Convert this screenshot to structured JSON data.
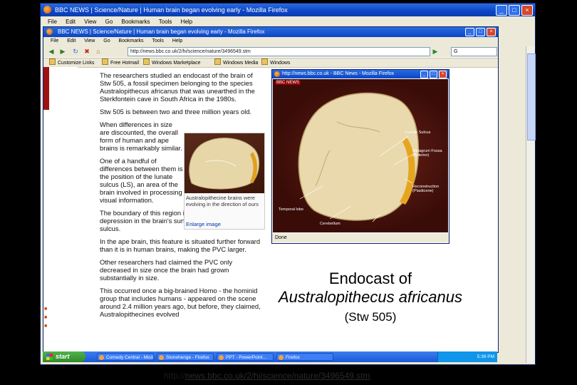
{
  "outer_window": {
    "title": "BBC NEWS | Science/Nature | Human brain began evolving early - Mozilla Firefox",
    "menu": [
      "File",
      "Edit",
      "View",
      "Go",
      "Bookmarks",
      "Tools",
      "Help"
    ],
    "buttons": [
      "_",
      "□",
      "×"
    ]
  },
  "inner_window": {
    "title": "BBC NEWS | Science/Nature | Human brain began evolving early - Mozilla Firefox",
    "menu": [
      "File",
      "Edit",
      "View",
      "Go",
      "Bookmarks",
      "Tools",
      "Help"
    ],
    "buttons": [
      "_",
      "□",
      "×"
    ],
    "url": "http://news.bbc.co.uk/2/hi/science/nature/3496549.stm",
    "search_placeholder": "G",
    "bookmarks": [
      "Customize Links",
      "Free Hotmail",
      "Windows Marketplace",
      "Windows Media",
      "Windows"
    ]
  },
  "article": {
    "paragraphs": [
      "The researchers studied an endocast of the brain of Stw 505, a fossil specimen belonging to the species Australopithecus africanus that was unearthed in the Sterkfontein cave in South Africa in the 1980s.",
      "Stw 505 is between two and three million years old.",
      "When differences in size are discounted, the overall form of human and ape brains is remarkably similar.",
      "One of a handful of differences between them is the position of the lunate sulcus (LS), an area of the brain involved in processing visual information.",
      "The boundary of this region is defined by an arching depression in the brain's surface called the lunate sulcus.",
      "In the ape brain, this feature is situated further forward than it is in human brains, making the PVC larger.",
      "Other researchers had claimed the PVC only decreased in size once the brain had grown substantially in size.",
      "This occurred once a big-brained Homo - the hominid group that includes humans - appeared on the scene around 2.4 million years ago, but before, they claimed, Australopithecines evolved"
    ],
    "figure": {
      "caption": "Australopithecine brains were evolving in the direction of ours",
      "link": "Enlarge image"
    }
  },
  "popup": {
    "title": "http://news.bbc.co.uk - BBC News - Mozilla Firefox",
    "brand": "BBC NEWS",
    "labels": {
      "lunate": "Lunate Sulcus",
      "malagrum": "Malagrum Fossa (Anterior)",
      "recon": "Reconstruction (Plasticene)",
      "temporal": "Temporal lobe",
      "cerebellum": "Cerebellum"
    },
    "status": "Done"
  },
  "caption": {
    "line1": "Endocast of",
    "line2": "Australopithecus africanus",
    "line3": "(Stw 505)"
  },
  "taskbar": {
    "start": "start",
    "items": [
      "Comedy Central - Mozilla...",
      "Stonehenge - Firefox",
      "PPT - PowerPoint...",
      "Firefox"
    ],
    "tray": "5:39 PM"
  },
  "source": {
    "prefix": "http://",
    "link": "news.bbc.co.uk/2/hi/science/nature/3496549.stm"
  }
}
